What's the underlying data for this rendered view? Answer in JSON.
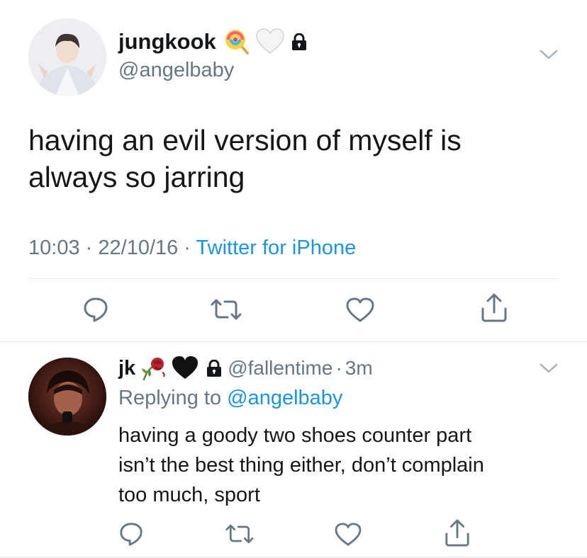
{
  "tweet": {
    "display_name": "jungkook",
    "handle": "@angelbaby",
    "name_emojis": [
      "lollipop-icon",
      "white-heart-icon",
      "lock-icon"
    ],
    "text_line1": "having an evil version of myself is",
    "text_line2": "always so jarring",
    "time": "10:03",
    "date": "22/10/16",
    "separator": "·",
    "source": "Twitter for iPhone"
  },
  "reply": {
    "display_name": "jk",
    "name_emojis": [
      "wilted-rose-icon",
      "black-heart-icon",
      "lock-icon"
    ],
    "handle": "@fallentime",
    "separator": "·",
    "age": "3m",
    "replying_prefix": "Replying to",
    "replying_handle": "@angelbaby",
    "text_line1": "having a goody two shoes counter part",
    "text_line2": "isn’t the best thing either, don’t complain",
    "text_line3": "too much, sport"
  },
  "colors": {
    "text": "#14171a",
    "muted": "#657786",
    "link": "#1b95e0",
    "divider": "#e1e8ed"
  }
}
